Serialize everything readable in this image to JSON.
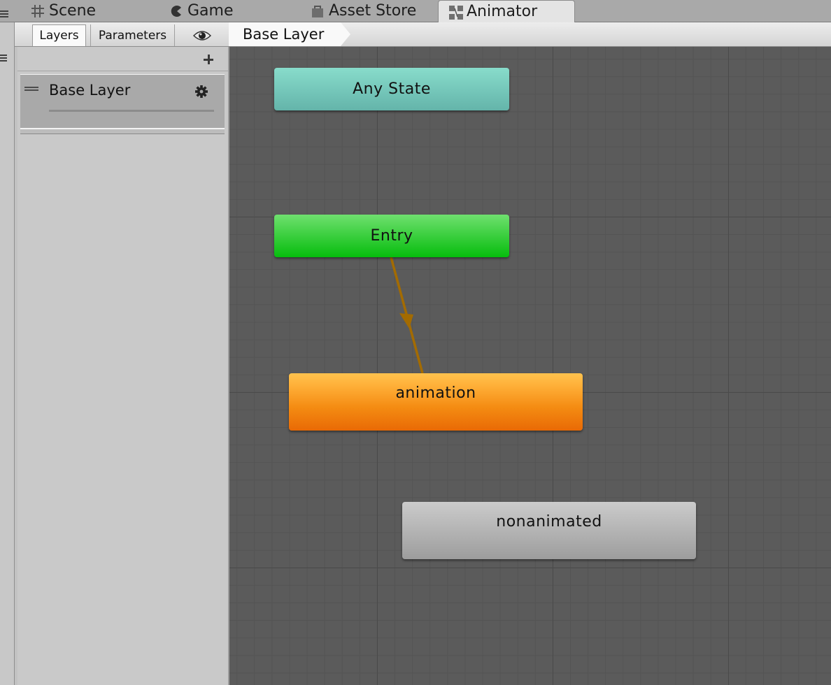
{
  "window_tabs": [
    {
      "label": "Scene",
      "icon": "scene-grid-icon",
      "active": false
    },
    {
      "label": "Game",
      "icon": "pacman-icon",
      "active": false
    },
    {
      "label": "Asset Store",
      "icon": "shopping-bag-icon",
      "active": false
    },
    {
      "label": "Animator",
      "icon": "animator-icon",
      "active": true
    }
  ],
  "toolbar": {
    "tabs": [
      {
        "label": "Layers",
        "selected": true
      },
      {
        "label": "Parameters",
        "selected": false
      }
    ],
    "eye_icon": "eye-icon",
    "breadcrumb": "Base Layer"
  },
  "layers_panel": {
    "add_icon": "plus-icon",
    "layers": [
      {
        "name": "Base Layer",
        "settings_icon": "gear-icon",
        "drag_icon": "drag-handle-icon"
      }
    ]
  },
  "graph": {
    "states": [
      {
        "id": "any",
        "label": "Any State",
        "kind": "any-state",
        "color": "#7ccbbd"
      },
      {
        "id": "entry",
        "label": "Entry",
        "kind": "entry",
        "color": "#10c51a"
      },
      {
        "id": "anim",
        "label": "animation",
        "kind": "default-state",
        "color": "#f4931b"
      },
      {
        "id": "non",
        "label": "nonanimated",
        "kind": "state",
        "color": "#b0b0b0"
      }
    ],
    "transitions": [
      {
        "from": "Entry",
        "to": "animation",
        "color": "#a36b00"
      }
    ]
  }
}
